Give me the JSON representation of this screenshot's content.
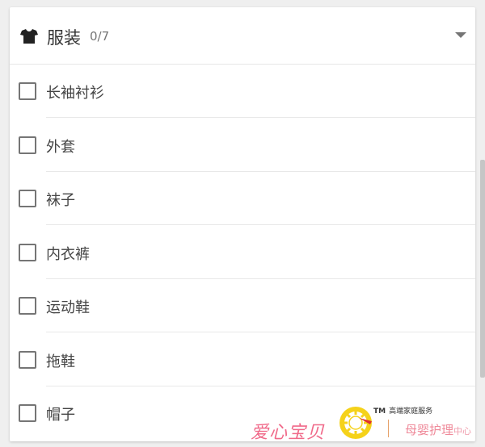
{
  "group": {
    "title": "服装",
    "count": "0/7",
    "icon": "shirt-icon",
    "expanded": true
  },
  "items": [
    {
      "label": "长袖衬衫",
      "checked": false
    },
    {
      "label": "外套",
      "checked": false
    },
    {
      "label": "袜子",
      "checked": false
    },
    {
      "label": "内衣裤",
      "checked": false
    },
    {
      "label": "运动鞋",
      "checked": false
    },
    {
      "label": "拖鞋",
      "checked": false
    },
    {
      "label": "帽子",
      "checked": false
    }
  ],
  "watermark": {
    "brand": "爱心宝贝",
    "tm_label": "TM",
    "tagline": "高端家庭服务",
    "center_main": "母婴护理",
    "center_suffix": "中心"
  },
  "colors": {
    "checkbox_border": "#757575",
    "accent_pink": "#f06a8a",
    "logo_yellow": "#f5d21a"
  }
}
